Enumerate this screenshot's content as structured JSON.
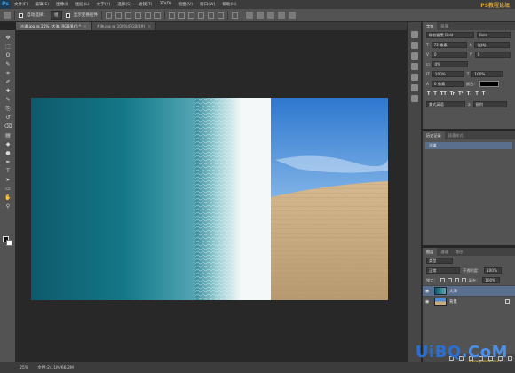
{
  "app": {
    "logo": "Ps",
    "menu": [
      "文件(F)",
      "编辑(E)",
      "图像(I)",
      "图层(L)",
      "文字(Y)",
      "选择(S)",
      "滤镜(T)",
      "3D(D)",
      "视图(V)",
      "窗口(W)",
      "帮助(H)"
    ],
    "watermark_top": "PS教程论坛"
  },
  "options": {
    "auto_select_label": "自动选择：",
    "auto_select_value": "组",
    "show_transform_label": "显示变换控件"
  },
  "tabs": [
    {
      "label": "沙滩.jpg @ 25% (大海, RGB/8#) *",
      "active": true
    },
    {
      "label": "大海.jpg @ 100%(RGB/8#)",
      "active": false
    }
  ],
  "toolbox": {
    "tools": [
      "move-tool-icon",
      "marquee-tool-icon",
      "lasso-tool-icon",
      "quick-select-tool-icon",
      "crop-tool-icon",
      "eyedropper-tool-icon",
      "healing-brush-tool-icon",
      "brush-tool-icon",
      "clone-stamp-tool-icon",
      "history-brush-tool-icon",
      "eraser-tool-icon",
      "gradient-tool-icon",
      "blur-tool-icon",
      "dodge-tool-icon",
      "pen-tool-icon",
      "type-tool-icon",
      "path-select-tool-icon",
      "shape-tool-icon",
      "hand-tool-icon",
      "zoom-tool-icon"
    ],
    "tool_glyphs": [
      "✥",
      "⬚",
      "ʘ",
      "✎",
      "⌗",
      "✐",
      "✚",
      "✎",
      "⎘",
      "↺",
      "⌫",
      "▤",
      "◆",
      "●",
      "✒",
      "T",
      "➤",
      "▭",
      "✋",
      "⚲"
    ]
  },
  "character_panel": {
    "tabs": [
      "字符",
      "段落"
    ],
    "font_family": "微软雅黑 Bold",
    "font_style": "Bold",
    "font_size": "72 像素",
    "leading": "(自动)",
    "kerning": "0",
    "tracking": "0",
    "scale_percent": "0%",
    "vscale": "100%",
    "hscale": "100%",
    "baseline": "0 像素",
    "color_label": "颜色：",
    "antialias": "美式英语",
    "antialias_mode": "锐利",
    "format_buttons": [
      "T",
      "T",
      "TT",
      "Tr",
      "T¹",
      "T₁",
      "T",
      "T"
    ],
    "text_color": "#000000"
  },
  "history_panel": {
    "tabs": [
      "历史记录",
      "段落样式"
    ],
    "entries": [
      "沙滩"
    ]
  },
  "layers_panel": {
    "tabs": [
      "图层",
      "通道",
      "路径"
    ],
    "kind": "类型",
    "blend_mode": "正常",
    "opacity_label": "不透明度：",
    "opacity": "100%",
    "lock_label": "锁定：",
    "fill_label": "填充：",
    "fill": "100%",
    "layers": [
      {
        "name": "大海",
        "selected": true
      },
      {
        "name": "背景",
        "selected": false
      }
    ]
  },
  "status": {
    "zoom": "25%",
    "doc": "文档:24.1M/66.2M"
  },
  "watermark_bottom": {
    "main_left": "UiBQ",
    "main_right": ".CoM",
    "small": "www.psahz.com"
  },
  "colors": {
    "accent_selected": "#5a6f8e",
    "sea_dark": "#0e5a6c",
    "sky_blue": "#3d8cd8",
    "sand": "#c9ab80"
  }
}
